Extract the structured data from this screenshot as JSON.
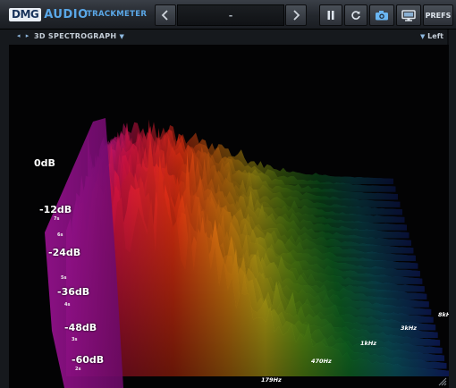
{
  "brand": {
    "logo_left": "DMG",
    "logo_right": "AUDIO",
    "product": "TRACKMETER"
  },
  "toolbar": {
    "prev_icon": "chevron-left-icon",
    "preset_value": "-",
    "next_icon": "chevron-right-icon",
    "pause_icon": "pause-icon",
    "reset_icon": "refresh-icon",
    "snapshot_icon": "camera-icon",
    "display_icon": "monitor-icon",
    "prefs_label": "PREFS"
  },
  "view": {
    "nav_arrows": "◂ ▸",
    "mode": "3D SPECTROGRAPH",
    "channel": "Left"
  },
  "axes": {
    "db_ticks": [
      "0dB",
      "-12dB",
      "-24dB",
      "-36dB",
      "-48dB",
      "-60dB"
    ],
    "time_ticks": [
      "7s",
      "6s",
      "5s",
      "4s",
      "3s",
      "2s"
    ],
    "freq_ticks": [
      "179Hz",
      "470Hz",
      "1kHz",
      "3kHz",
      "8kH"
    ]
  },
  "colors": {
    "accent": "#5aa8e8",
    "background": "#030304"
  }
}
